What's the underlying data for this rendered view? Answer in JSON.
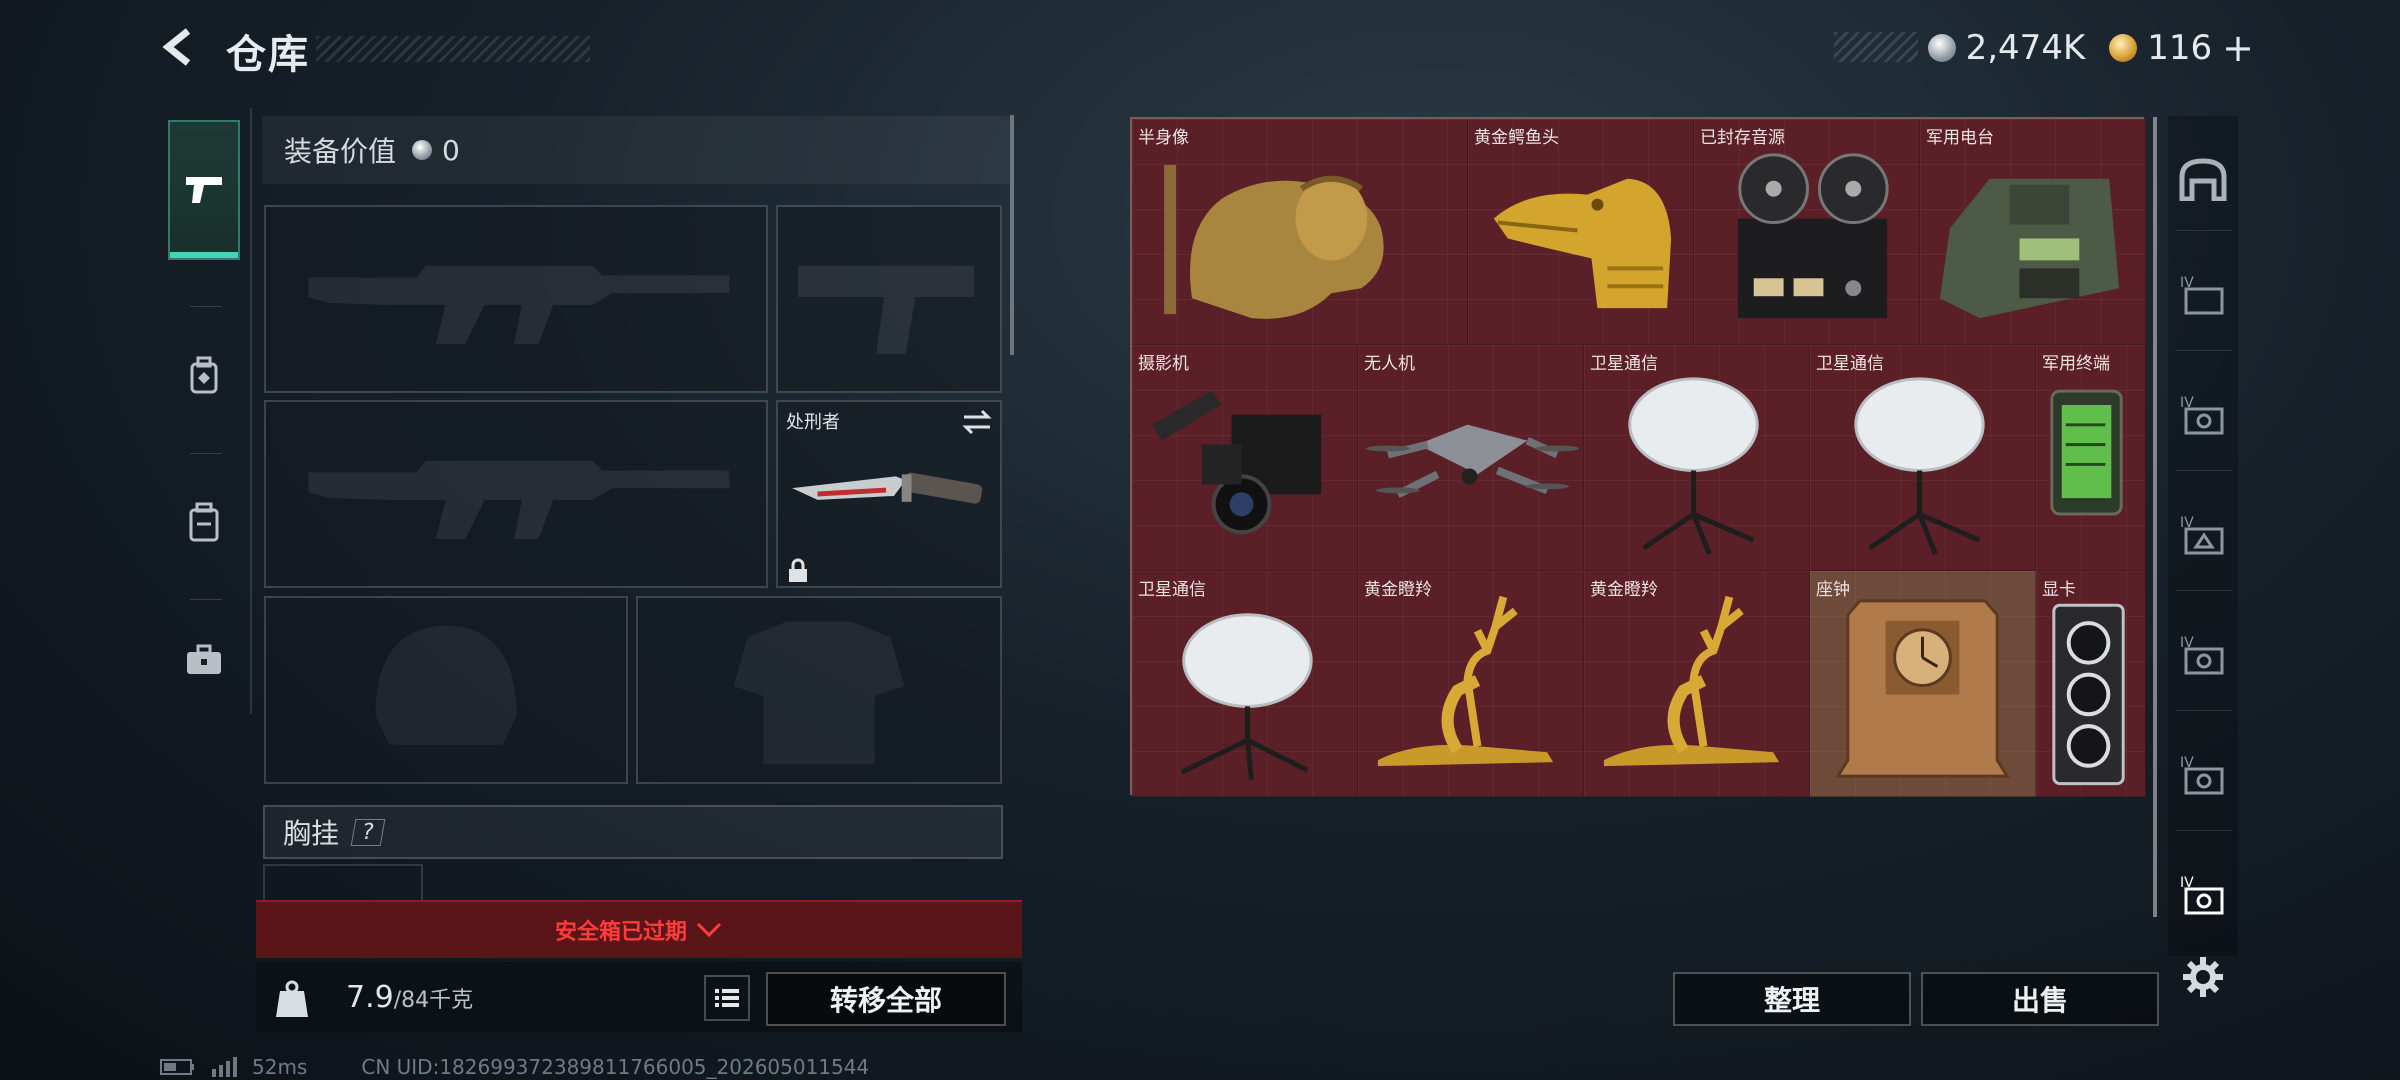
{
  "header": {
    "title": "仓库",
    "currency": [
      {
        "icon": "silver-coin-icon",
        "value": "2,474K"
      },
      {
        "icon": "gold-coin-icon",
        "value": "116"
      }
    ],
    "add_label": "+"
  },
  "left_sidebar": {
    "tabs": [
      {
        "name": "weapons",
        "icon": "pistol-icon",
        "active": true
      },
      {
        "name": "armor",
        "icon": "backpack-icon",
        "active": false
      },
      {
        "name": "container",
        "icon": "case-icon",
        "active": false
      },
      {
        "name": "toolbox",
        "icon": "briefcase-icon",
        "active": false
      }
    ]
  },
  "equipment": {
    "value_label": "装备价值",
    "value": "0",
    "knife_label": "处刑者",
    "chest_rig_label": "胸挂",
    "help_label": "?",
    "safe_box_text": "安全箱已过期",
    "weight_current": "7.9",
    "weight_max": "/84千克",
    "transfer_all_label": "转移全部"
  },
  "items": [
    {
      "label": "半身像",
      "kind": "bust"
    },
    {
      "label": "黄金鳄鱼头",
      "kind": "gold-croc"
    },
    {
      "label": "已封存音源",
      "kind": "tape-deck"
    },
    {
      "label": "军用电台",
      "kind": "radio"
    },
    {
      "label": "摄影机",
      "kind": "camera"
    },
    {
      "label": "无人机",
      "kind": "drone"
    },
    {
      "label": "卫星通信",
      "kind": "dish"
    },
    {
      "label": "卫星通信",
      "kind": "dish"
    },
    {
      "label": "军用终端",
      "kind": "terminal"
    },
    {
      "label": "卫星通信",
      "kind": "dish"
    },
    {
      "label": "黄金瞪羚",
      "kind": "gazelle"
    },
    {
      "label": "黄金瞪羚",
      "kind": "gazelle"
    },
    {
      "label": "座钟",
      "kind": "clock"
    },
    {
      "label": "显卡",
      "kind": "gpu"
    }
  ],
  "actions": {
    "sort_label": "整理",
    "sell_label": "出售"
  },
  "status": {
    "ping": "52ms",
    "uid": "CN UID:182699372389811766005_202605011544"
  },
  "colors": {
    "grid_bg": "#5b1f27",
    "accent": "#44d4b8",
    "danger": "#ff3b3b"
  }
}
